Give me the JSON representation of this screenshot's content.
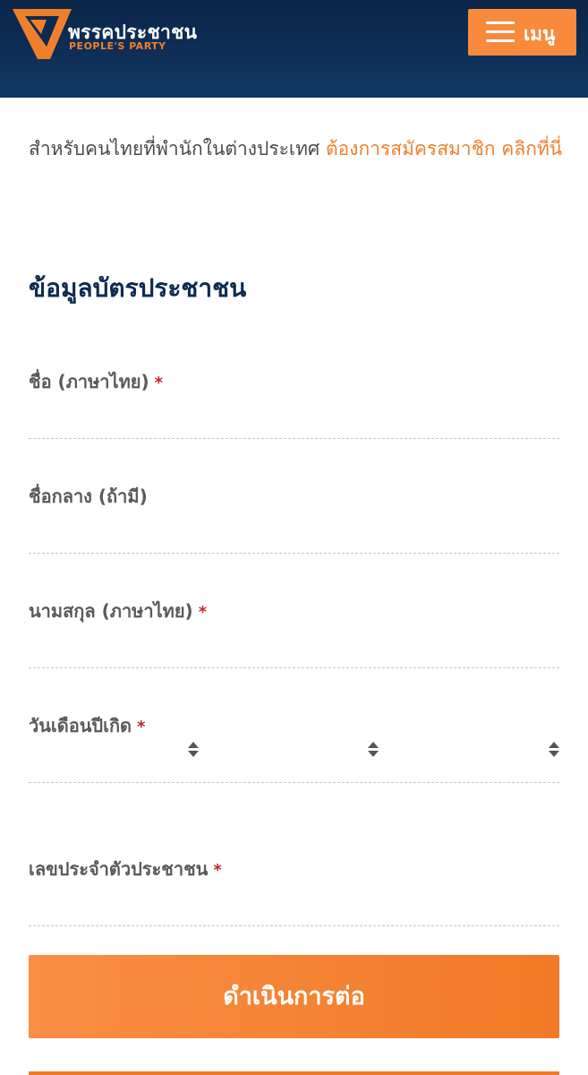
{
  "header": {
    "brand_th": "พรรคประชาชน",
    "brand_en": "PEOPLE'S PARTY",
    "menu_label": "เมนู",
    "logo_icon": "peoples-party-logo",
    "menu_icon": "hamburger-icon"
  },
  "notice": {
    "text": "สำหรับคนไทยที่พำนักในต่างประเทศ ",
    "link": "ต้องการสมัครสมาชิก คลิกที่นี่"
  },
  "section": {
    "title": "ข้อมูลบัตรประชาชน"
  },
  "fields": {
    "first_name": {
      "label": "ชื่อ (ภาษาไทย)",
      "required": "*",
      "value": ""
    },
    "middle_name": {
      "label": "ชื่อกลาง (ถ้ามี)",
      "value": ""
    },
    "last_name": {
      "label": "นามสกุล (ภาษาไทย)",
      "required": "*",
      "value": ""
    },
    "birth_date": {
      "label": "วันเดือนปีเกิด",
      "required": "*",
      "day": "",
      "month": "",
      "year": ""
    },
    "id_number": {
      "label": "เลขประจำตัวประชาชน",
      "required": "*",
      "value": ""
    }
  },
  "submit": {
    "label": "ดำเนินการต่อ"
  },
  "colors": {
    "header_bg": "#0b2547",
    "accent": "#f07f2c",
    "title": "#0d2b50",
    "required": "#c0282e"
  }
}
